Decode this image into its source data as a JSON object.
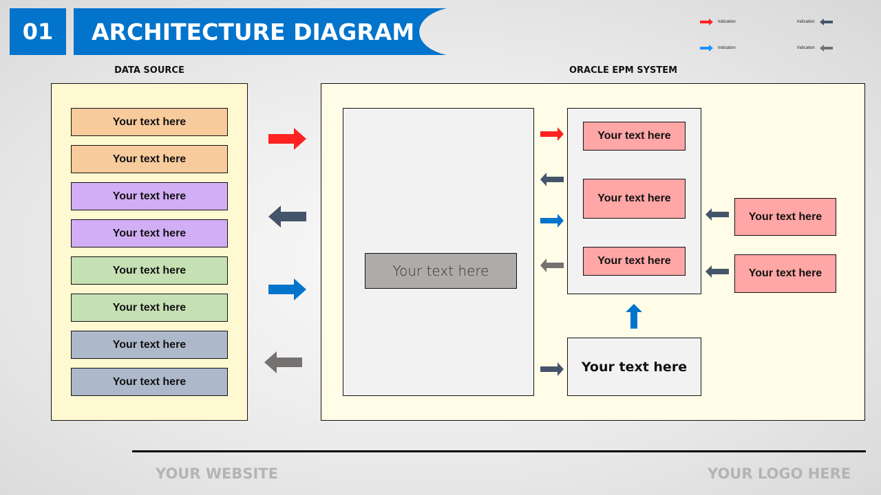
{
  "header": {
    "number": "01",
    "title": "ARCHITECTURE DIAGRAM",
    "accent_color": "#0274cc"
  },
  "legend": [
    {
      "label": "Indication",
      "icon": "arrow-right-icon",
      "color": "#ff2222"
    },
    {
      "label": "Indication",
      "icon": "arrow-left-icon",
      "color": "#44546a"
    },
    {
      "label": "Indication",
      "icon": "arrow-right-icon",
      "color": "#1e90ff"
    },
    {
      "label": "Indication",
      "icon": "arrow-left-icon",
      "color": "#767171"
    }
  ],
  "data_source": {
    "label": "DATA SOURCE",
    "items": [
      {
        "text": "Your text here",
        "color": "#f8cb9c"
      },
      {
        "text": "Your text here",
        "color": "#f8cb9c"
      },
      {
        "text": "Your text here",
        "color": "#d2aef5"
      },
      {
        "text": "Your text here",
        "color": "#d2aef5"
      },
      {
        "text": "Your text here",
        "color": "#c5e0b3"
      },
      {
        "text": "Your text here",
        "color": "#c5e0b3"
      },
      {
        "text": "Your text here",
        "color": "#adb9ca"
      },
      {
        "text": "Your text here",
        "color": "#adb9ca"
      }
    ]
  },
  "connector_arrows": [
    {
      "direction": "right",
      "color": "#ff2222"
    },
    {
      "direction": "left",
      "color": "#44546a"
    },
    {
      "direction": "right",
      "color": "#0274cc"
    },
    {
      "direction": "left",
      "color": "#767171"
    }
  ],
  "epm": {
    "label": "ORACLE EPM SYSTEM",
    "center_box": "Your text here",
    "inner_items": [
      "Your text here",
      "Your text here",
      "Your text here"
    ],
    "side_items": [
      "Your text here",
      "Your text here"
    ],
    "bottom_box": "Your text here",
    "inner_arrows": [
      {
        "direction": "right",
        "color": "#ff2222"
      },
      {
        "direction": "left",
        "color": "#44546a"
      },
      {
        "direction": "right",
        "color": "#0274cc"
      },
      {
        "direction": "left",
        "color": "#767171"
      }
    ]
  },
  "footer": {
    "website": "YOUR WEBSITE",
    "logo": "YOUR LOGO HERE"
  }
}
